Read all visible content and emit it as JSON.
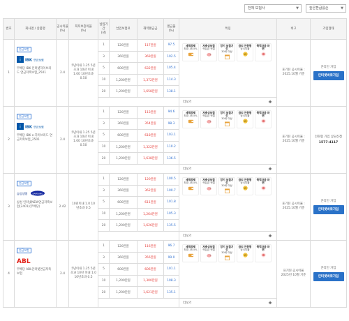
{
  "filters": {
    "company_select": "전체 보험사",
    "sort_select": "높은환급률순"
  },
  "table": {
    "headers": [
      "번호",
      "회사명 / 상품명",
      "공시이율",
      "최저보증이율",
      "납입기간",
      "납입보험료",
      "해약환급금",
      "환급율",
      "특징",
      "비고",
      "가입형태"
    ],
    "header_sub": {
      "rate": "(%)",
      "min": "(%)",
      "period": "(년)",
      "prem": "",
      "refund": "",
      "ratio": "(%)"
    },
    "more_label": "더보기",
    "products": [
      {
        "no": "1",
        "badge": "연금보험",
        "logo_text": "IBK 연금보험",
        "name": "무배당 IBK 인터넷하이브리드 연금저축보험_2501",
        "rate": "2.4",
        "min_rate": "5년이내 1.25 5년초과 10년 이내 1.00 10년초과 0.50",
        "rows": [
          {
            "period": "1",
            "prem": "120만원",
            "refund": "117만원",
            "ratio": "97.5"
          },
          {
            "period": "3",
            "prem": "360만원",
            "refund": "369만원",
            "ratio": "102.5"
          },
          {
            "period": "5",
            "prem": "600만원",
            "refund": "632만원",
            "ratio": "105.4"
          },
          {
            "period": "10",
            "prem": "1,200만원",
            "refund": "1,372만원",
            "ratio": "114.3"
          },
          {
            "period": "20",
            "prem": "1,200만원",
            "refund": "1,658만원",
            "ratio": "138.1"
          }
        ],
        "note": "표기된 공시이율 : 2025.10월 기준",
        "join_type": "온라인 가입",
        "phone": "",
        "button": "인터넷바로가입"
      },
      {
        "no": "2",
        "badge": "연금보험",
        "logo_text": "IBK 연금보험",
        "name": "무배당 IBK e-하이브리드 연금저축보험_2501",
        "rate": "2.4",
        "min_rate": "5년이내 1.25 5년초과 10년 이내 1.00 10년초과 0.50",
        "rows": [
          {
            "period": "1",
            "prem": "120만원",
            "refund": "113만원",
            "ratio": "94.6"
          },
          {
            "period": "3",
            "prem": "360만원",
            "refund": "354만원",
            "ratio": "98.3"
          },
          {
            "period": "5",
            "prem": "600만원",
            "refund": "618만원",
            "ratio": "103.1"
          },
          {
            "period": "10",
            "prem": "1,200만원",
            "refund": "1,322만원",
            "ratio": "110.2"
          },
          {
            "period": "20",
            "prem": "1,200만원",
            "refund": "1,638만원",
            "ratio": "136.5"
          }
        ],
        "note": "표기된 공시이율 : 2025.10월 기준",
        "join_type": "전화형 가입 상담신청",
        "phone": "1577-4117",
        "button": ""
      },
      {
        "no": "3",
        "badge": "연금보험",
        "logo_text": "삼성생명 SAMSUNG",
        "name": "삼성 인터넷NEW연금저축보험(2401)(무배당)",
        "rate": "2.42",
        "min_rate": "10년이내 1.0 10년초과 0.5",
        "rows": [
          {
            "period": "1",
            "prem": "120만원",
            "refund": "120만원",
            "ratio": "100.5"
          },
          {
            "period": "3",
            "prem": "360만원",
            "refund": "362만원",
            "ratio": "100.7"
          },
          {
            "period": "5",
            "prem": "600만원",
            "refund": "611만원",
            "ratio": "101.8"
          },
          {
            "period": "10",
            "prem": "1,200만원",
            "refund": "1,264만원",
            "ratio": "105.3"
          },
          {
            "period": "20",
            "prem": "1,200만원",
            "refund": "1,626만원",
            "ratio": "135.5"
          }
        ],
        "note": "표기된 공시이율 : 2025.10월 기준",
        "join_type": "온라인 가입",
        "phone": "",
        "button": "인터넷바로가입"
      },
      {
        "no": "4",
        "badge": "연금보험",
        "logo_text": "ABL",
        "name": "무배당 ABL인터넷연금저축보험",
        "rate": "2.4",
        "min_rate": "5년이내 1.25 5년초과 10년 이내 1.0 10년초과 0.5",
        "rows": [
          {
            "period": "1",
            "prem": "120만원",
            "refund": "116만원",
            "ratio": "96.7"
          },
          {
            "period": "3",
            "prem": "360만원",
            "refund": "356만원",
            "ratio": "99.0"
          },
          {
            "period": "5",
            "prem": "600만원",
            "refund": "606만원",
            "ratio": "101.1"
          },
          {
            "period": "10",
            "prem": "1,200만원",
            "refund": "1,300만원",
            "ratio": "108.3"
          },
          {
            "period": "20",
            "prem": "1,200만원",
            "refund": "1,621만원",
            "ratio": "135.1"
          }
        ],
        "note": "표기된 공시이율 2025년 10월 기준",
        "join_type": "온라인 가입",
        "phone": "",
        "button": "인터넷바로가입"
      }
    ],
    "features": [
      {
        "title": "세액공제",
        "sub": "최대 16.5%",
        "icon": "wallet-icon"
      },
      {
        "title": "저축성보험",
        "sub": "적립금 적립",
        "icon": "piggy-bank-icon"
      },
      {
        "title": "장기 보험기간",
        "sub": "30세 이상",
        "icon": "calendar-icon"
      },
      {
        "title": "금리 연동형",
        "sub": "공시이율",
        "icon": "coin-icon"
      },
      {
        "title": "목적자금 마련",
        "sub": "",
        "icon": "target-icon"
      }
    ]
  },
  "colors": {
    "accent": "#2a72c8",
    "red": "#e53935",
    "blue": "#2f6fcf"
  }
}
